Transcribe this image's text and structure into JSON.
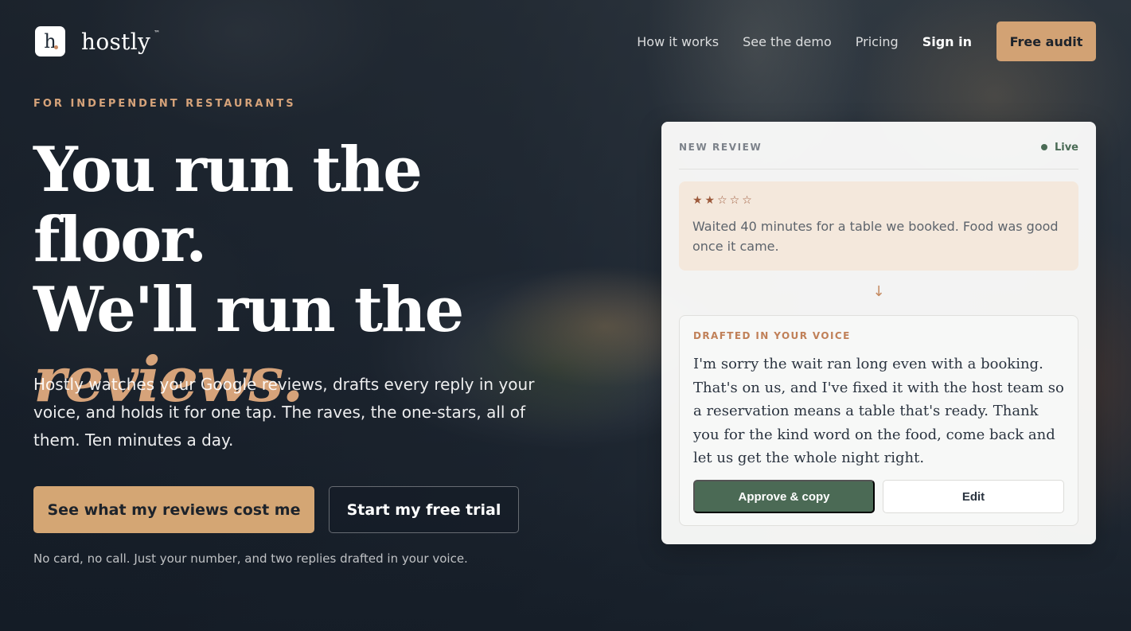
{
  "nav": {
    "logo_letter": "h",
    "brand": "hostly",
    "trademark": "™",
    "links": [
      "How it works",
      "See the demo",
      "Pricing"
    ],
    "sign_in": "Sign in",
    "cta": "Free audit"
  },
  "hero": {
    "eyebrow": "FOR INDEPENDENT RESTAURANTS",
    "headline_line1": "You run the floor.",
    "headline_line2": "We'll run the",
    "headline_accent": "reviews.",
    "subhead": "Hostly watches your Google reviews, drafts every reply in your voice, and holds it for one tap. The raves, the one-stars, all of them. Ten minutes a day.",
    "primary_cta": "See what my reviews cost me",
    "secondary_cta": "Start my free trial",
    "fineprint": "No card, no call. Just your number, and two replies drafted in your voice."
  },
  "card": {
    "label": "NEW REVIEW",
    "status": "Live",
    "stars_display": "★★☆☆☆",
    "rating": 2,
    "review_text": "Waited 40 minutes for a table we booked. Food was good once it came.",
    "arrow": "↓",
    "draft_label": "DRAFTED IN YOUR VOICE",
    "draft_text": "I'm sorry the wait ran long even with a booking. That's on us, and I've fixed it with the host team so a reservation means a table that's ready. Thank you for the kind word on the food, come back and let us get the whole night right.",
    "approve_label": "Approve & copy",
    "edit_label": "Edit"
  },
  "colors": {
    "accent": "#d4a674",
    "approve": "#4b6a55",
    "star": "#9d5a3c",
    "review_bg": "#f4e8dc"
  }
}
